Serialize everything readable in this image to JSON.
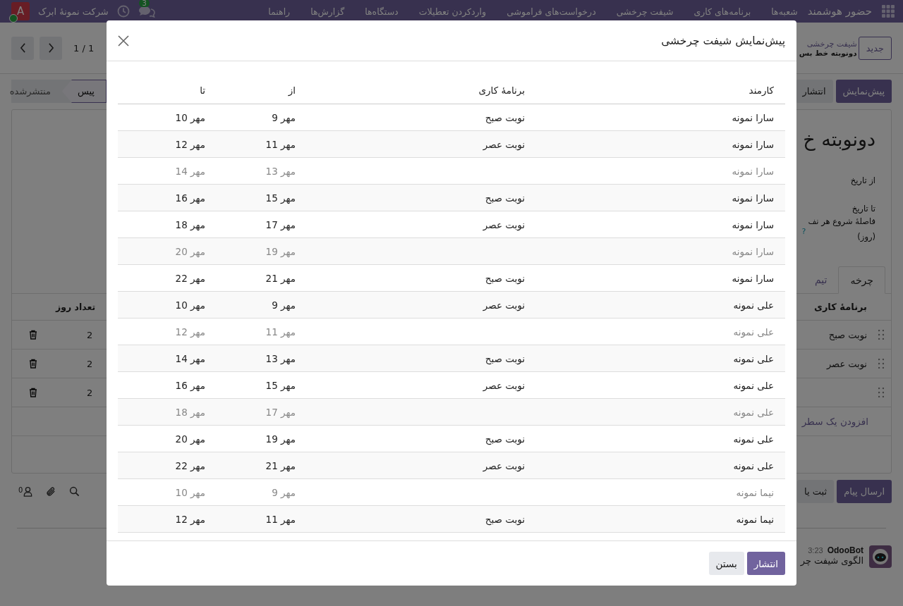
{
  "navbar": {
    "brand": "حضور هوشمند",
    "menu": [
      "شعبه‌ها",
      "برنامه‌های کاری",
      "شیفت چرخشی",
      "درخواست‌های فراموشی",
      "واردکردن تعطیلات",
      "دستگاه‌ها",
      "گزارش‌ها",
      "راهنما"
    ],
    "chat_badge": "3",
    "company": "شرکت نمونهٔ ابرک",
    "avatar": "A"
  },
  "control_panel": {
    "new_button": "جدید",
    "breadcrumb": [
      "شیفت چرخشی",
      "دونوبته خط بس"
    ],
    "pager": "1 / 1"
  },
  "actions": [
    "پیش‌نمایش",
    "انتشار"
  ],
  "statusbar": [
    {
      "label": "پیس",
      "selected": true
    },
    {
      "label": "منتشرشده",
      "selected": false
    }
  ],
  "form": {
    "title": "دونوبته خ",
    "fields": [
      {
        "label": "از تاریخ"
      },
      {
        "label": "تا تاریخ"
      },
      {
        "label": "فاصلهٔ شروع هر نف",
        "label_2": "(روز)",
        "help": "?"
      }
    ],
    "tabs": [
      {
        "label": "چرخه",
        "selected": true
      },
      {
        "label": "تیم",
        "selected": false
      }
    ],
    "lines": {
      "columns": [
        "برنامهٔ کاری",
        "تعداد روز"
      ],
      "rows": [
        {
          "schedule": "نوبت صبح",
          "days": "2"
        },
        {
          "schedule": "نوبت عصر",
          "days": "2"
        },
        {
          "days": "2"
        }
      ],
      "add_line": "افزودن یک سطر"
    }
  },
  "chatter": {
    "send_button": "ارسال پیام",
    "log_button": "ثبت یا",
    "followers": "0",
    "message": {
      "author": "OdooBot",
      "time": "3:23",
      "body": "الگوی شیفت چر"
    }
  },
  "dialog": {
    "title": "پیش‌نمایش شیفت چرخشی",
    "columns": [
      "کارمند",
      "برنامهٔ کاری",
      "از",
      "تا"
    ],
    "rows": [
      {
        "employee": "سارا نمونه",
        "schedule": "نوبت صبح",
        "from": "9 مهر",
        "to": "10 مهر",
        "off": false
      },
      {
        "employee": "سارا نمونه",
        "schedule": "نوبت عصر",
        "from": "11 مهر",
        "to": "12 مهر",
        "off": false
      },
      {
        "employee": "سارا نمونه",
        "from": "13 مهر",
        "to": "14 مهر",
        "off": true
      },
      {
        "employee": "سارا نمونه",
        "schedule": "نوبت صبح",
        "from": "15 مهر",
        "to": "16 مهر",
        "off": false
      },
      {
        "employee": "سارا نمونه",
        "schedule": "نوبت عصر",
        "from": "17 مهر",
        "to": "18 مهر",
        "off": false
      },
      {
        "employee": "سارا نمونه",
        "from": "19 مهر",
        "to": "20 مهر",
        "off": true
      },
      {
        "employee": "سارا نمونه",
        "schedule": "نوبت صبح",
        "from": "21 مهر",
        "to": "22 مهر",
        "off": false
      },
      {
        "employee": "علی نمونه",
        "schedule": "نوبت عصر",
        "from": "9 مهر",
        "to": "10 مهر",
        "off": false
      },
      {
        "employee": "علی نمونه",
        "from": "11 مهر",
        "to": "12 مهر",
        "off": true
      },
      {
        "employee": "علی نمونه",
        "schedule": "نوبت صبح",
        "from": "13 مهر",
        "to": "14 مهر",
        "off": false
      },
      {
        "employee": "علی نمونه",
        "schedule": "نوبت عصر",
        "from": "15 مهر",
        "to": "16 مهر",
        "off": false
      },
      {
        "employee": "علی نمونه",
        "from": "17 مهر",
        "to": "18 مهر",
        "off": true
      },
      {
        "employee": "علی نمونه",
        "schedule": "نوبت صبح",
        "from": "19 مهر",
        "to": "20 مهر",
        "off": false
      },
      {
        "employee": "علی نمونه",
        "schedule": "نوبت عصر",
        "from": "21 مهر",
        "to": "22 مهر",
        "off": false
      },
      {
        "employee": "نیما نمونه",
        "from": "9 مهر",
        "to": "10 مهر",
        "off": true
      },
      {
        "employee": "نیما نمونه",
        "schedule": "نوبت صبح",
        "from": "11 مهر",
        "to": "12 مهر",
        "off": false
      }
    ],
    "buttons": [
      {
        "label": "انتشار",
        "kind": "primary"
      },
      {
        "label": "بستن",
        "kind": "secondary"
      }
    ]
  }
}
